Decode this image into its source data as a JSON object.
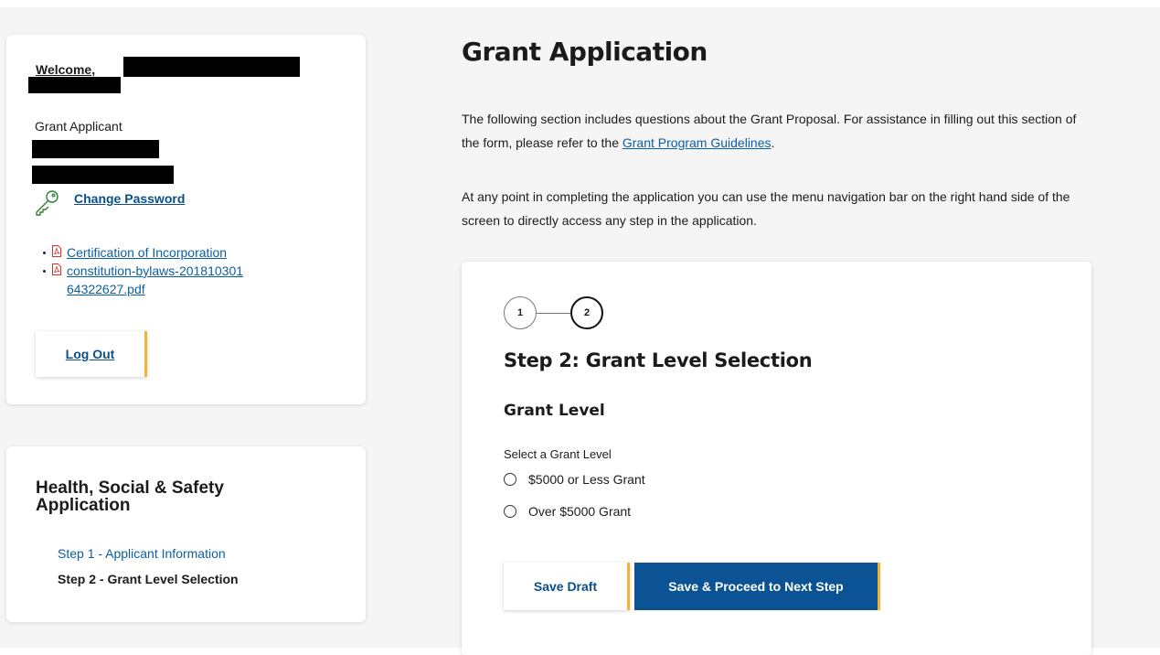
{
  "user": {
    "welcome_label": "Welcome,",
    "role": "Grant Applicant",
    "change_password_label": "Change Password",
    "documents": [
      "Certification of Incorporation",
      "constitution-bylaws-20181030164322627.pdf"
    ],
    "logout_label": "Log Out"
  },
  "nav": {
    "title": "Health, Social & Safety Application",
    "steps": [
      {
        "label": "Step 1 - Applicant Information",
        "active": false
      },
      {
        "label": "Step 2 - Grant Level Selection",
        "active": true
      }
    ]
  },
  "main": {
    "title": "Grant Application",
    "intro_before_link": "The following section includes questions about the Grant Proposal. For assistance in filling out this section of the form, please refer to the ",
    "intro_link": "Grant Program Guidelines",
    "intro_after_link": ".",
    "intro_2": "At any point in completing the application you can use the menu navigation bar on the right hand side of the screen to directly access any step in the application."
  },
  "form": {
    "stepper": [
      "1",
      "2"
    ],
    "current_step": 2,
    "step_heading": "Step 2: Grant Level Selection",
    "section_heading": "Grant Level",
    "field_label": "Select a Grant Level",
    "options": [
      "$5000 or Less Grant",
      "Over $5000 Grant"
    ],
    "save_draft_label": "Save Draft",
    "proceed_label": "Save & Proceed to Next Step"
  },
  "colors": {
    "link": "#0b5fa5",
    "primary_button": "#0b5394",
    "accent": "#f1b434",
    "pdf_icon": "#d9342b"
  }
}
